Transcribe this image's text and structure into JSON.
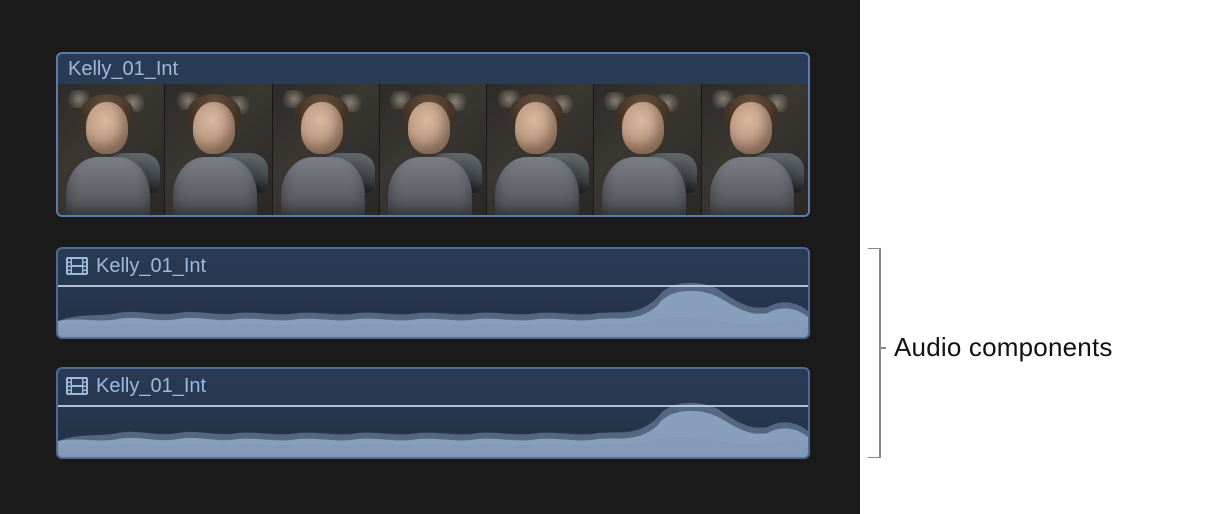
{
  "timeline": {
    "video_clip": {
      "title": "Kelly_01_Int",
      "frame_count": 7
    },
    "audio_clips": [
      {
        "label": "Kelly_01_Int"
      },
      {
        "label": "Kelly_01_Int"
      }
    ]
  },
  "annotation": {
    "label": "Audio components"
  },
  "icons": {
    "filmstrip": "filmstrip-icon"
  },
  "colors": {
    "clip_border": "#5a7db0",
    "clip_fill": "#2a3b56",
    "label_text": "#9fb9dd",
    "waveform": "#8fa5c4",
    "background": "#1a1a1a"
  }
}
